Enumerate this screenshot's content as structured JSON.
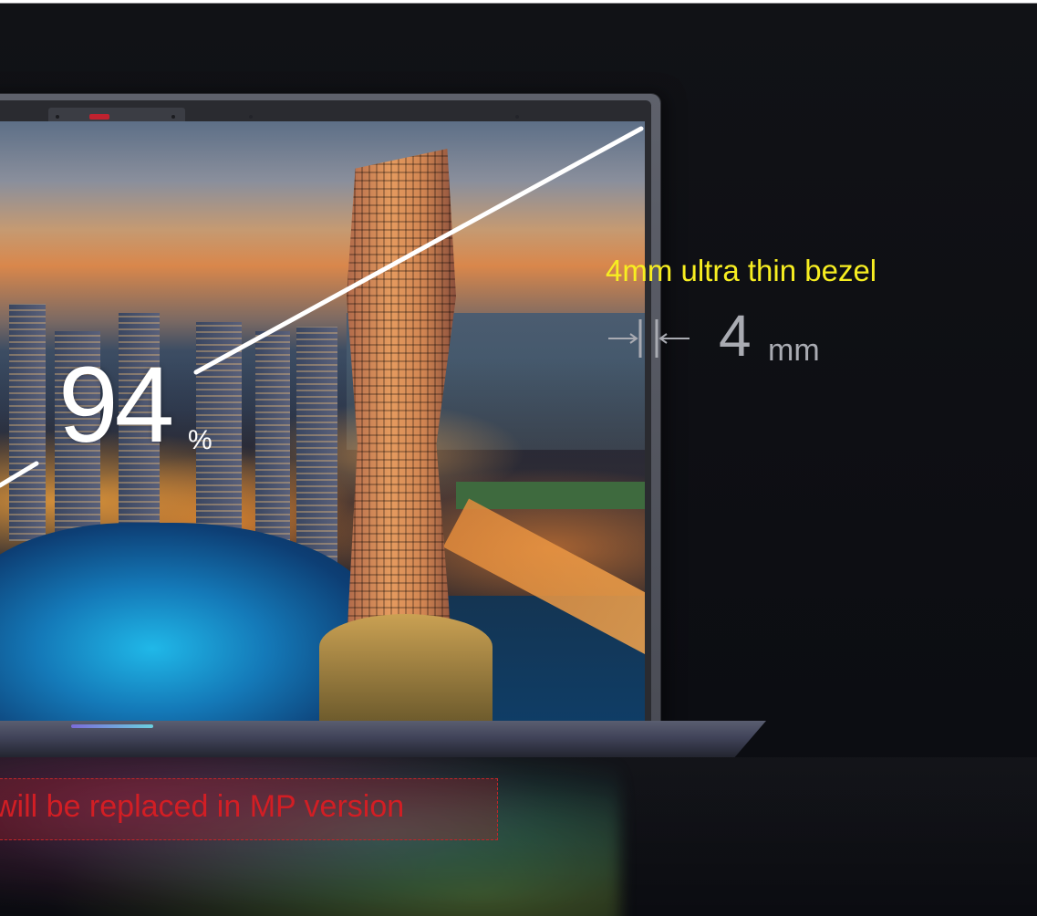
{
  "overlay": {
    "screen_ratio_value": "94",
    "screen_ratio_unit": "%",
    "bezel_title": "4mm ultra thin bezel",
    "bezel_value": "4",
    "bezel_unit": "mm",
    "placeholder_note": "will be replaced in MP version"
  },
  "colors": {
    "background": "#0c0d12",
    "bezel_title": "#f7ee21",
    "bezel_measure": "#a9abb2",
    "placeholder_text": "#d21e24",
    "diagonal_line": "#ffffff"
  },
  "icons": {
    "bezel_measure": "arrows-pointing-to-bars-icon"
  }
}
